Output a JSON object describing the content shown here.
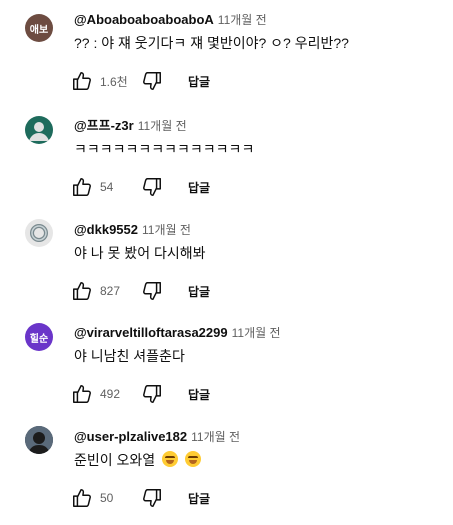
{
  "comments": [
    {
      "author": "@AboaboaboaboaboA",
      "time": "11개월 전",
      "text": "?? : 야 쟤 웃기다ㅋ 쟤 몇반이야? ㅇ? 우리반??",
      "likes": "1.6천",
      "reply_label": "답글",
      "avatar_text": "애보",
      "avatar_color": "#6d4c41"
    },
    {
      "author": "@프프-z3r",
      "time": "11개월 전",
      "text": "ㅋㅋㅋㅋㅋㅋㅋㅋㅋㅋㅋㅋㅋㅋ",
      "likes": "54",
      "reply_label": "답글",
      "avatar_text": "",
      "avatar_color": "#1e6b5c"
    },
    {
      "author": "@dkk9552",
      "time": "11개월 전",
      "text": "야 나 못 봤어 다시해봐",
      "likes": "827",
      "reply_label": "답글",
      "avatar_text": "",
      "avatar_color": "#e6e6e6"
    },
    {
      "author": "@virarveltilloftarasa2299",
      "time": "11개월 전",
      "text": "야 니남친 셔플춘다",
      "likes": "492",
      "reply_label": "답글",
      "avatar_text": "힐순",
      "avatar_color": "#6a35c9"
    },
    {
      "author": "@user-plzalive182",
      "time": "11개월 전",
      "text": "준빈이 오와열",
      "likes": "50",
      "reply_label": "답글",
      "avatar_text": "",
      "avatar_color": "#2b3a4a"
    }
  ]
}
